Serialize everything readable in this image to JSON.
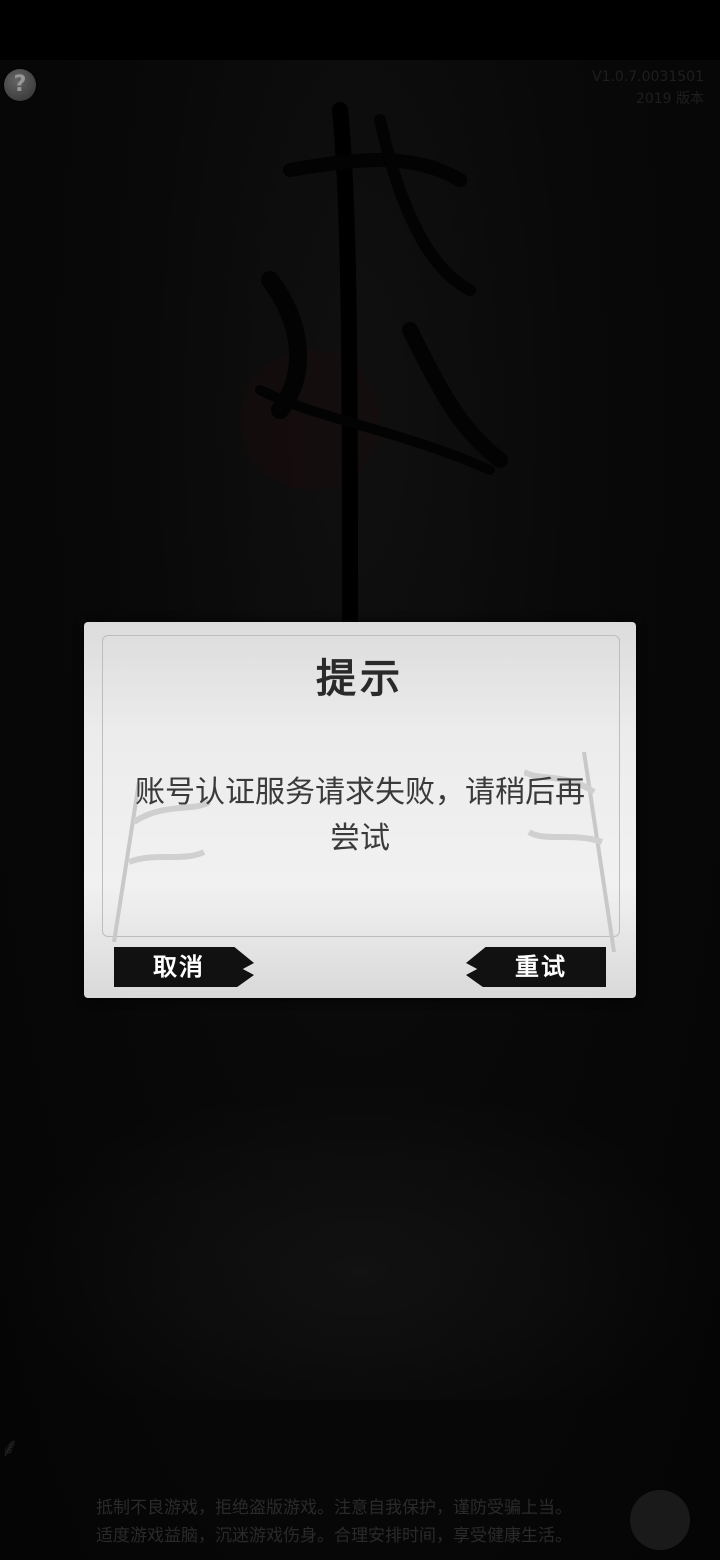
{
  "header": {
    "help_label": "?",
    "version_line1": "V1.0.7.0031501",
    "version_line2": "2019 版本"
  },
  "dialog": {
    "title": "提示",
    "message": "账号认证服务请求失败，请稍后再尝试",
    "cancel_label": "取消",
    "retry_label": "重试"
  },
  "footer": {
    "line1": "抵制不良游戏，拒绝盗版游戏。注意自我保护，谨防受骗上当。",
    "line2": "适度游戏益脑，沉迷游戏伤身。合理安排时间，享受健康生活。"
  }
}
